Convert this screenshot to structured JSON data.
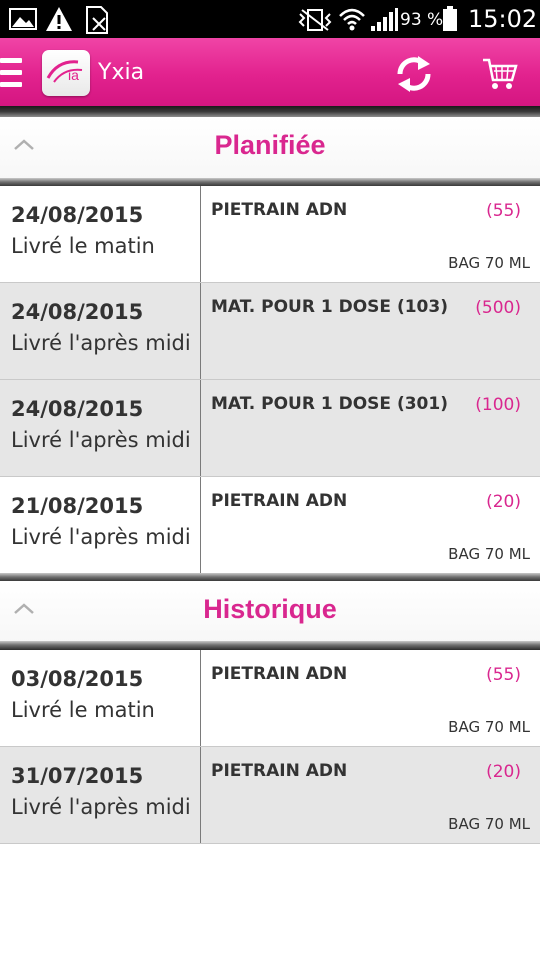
{
  "status_bar": {
    "battery": "93 %",
    "time": "15:02",
    "icons": [
      "image-icon",
      "warning-icon",
      "sim-icon",
      "vibrate-icon",
      "wifi-icon",
      "signal-icon",
      "battery-icon"
    ]
  },
  "app_bar": {
    "title": "Yxia",
    "logo_text": "Yxia",
    "icons": [
      "menu-icon",
      "refresh-icon",
      "cart-icon"
    ],
    "accent": "#e2228e"
  },
  "sections": [
    {
      "title": "Planifiée",
      "rows": [
        {
          "date": "24/08/2015",
          "delivery": "Livré le matin",
          "product": "PIETRAIN ADN",
          "qty": "(55)",
          "pack": "BAG 70 ML"
        },
        {
          "date": "24/08/2015",
          "delivery": "Livré l'après midi",
          "product": "MAT. POUR 1 DOSE (103)",
          "qty": "(500)",
          "pack": ""
        },
        {
          "date": "24/08/2015",
          "delivery": "Livré l'après midi",
          "product": "MAT. POUR 1 DOSE (301)",
          "qty": "(100)",
          "pack": ""
        },
        {
          "date": "21/08/2015",
          "delivery": "Livré l'après midi",
          "product": "PIETRAIN ADN",
          "qty": "(20)",
          "pack": "BAG 70 ML"
        }
      ]
    },
    {
      "title": "Historique",
      "rows": [
        {
          "date": "03/08/2015",
          "delivery": "Livré le matin",
          "product": "PIETRAIN ADN",
          "qty": "(55)",
          "pack": "BAG 70 ML"
        },
        {
          "date": "31/07/2015",
          "delivery": "Livré l'après midi",
          "product": "PIETRAIN ADN",
          "qty": "(20)",
          "pack": "BAG 70 ML"
        }
      ]
    }
  ]
}
